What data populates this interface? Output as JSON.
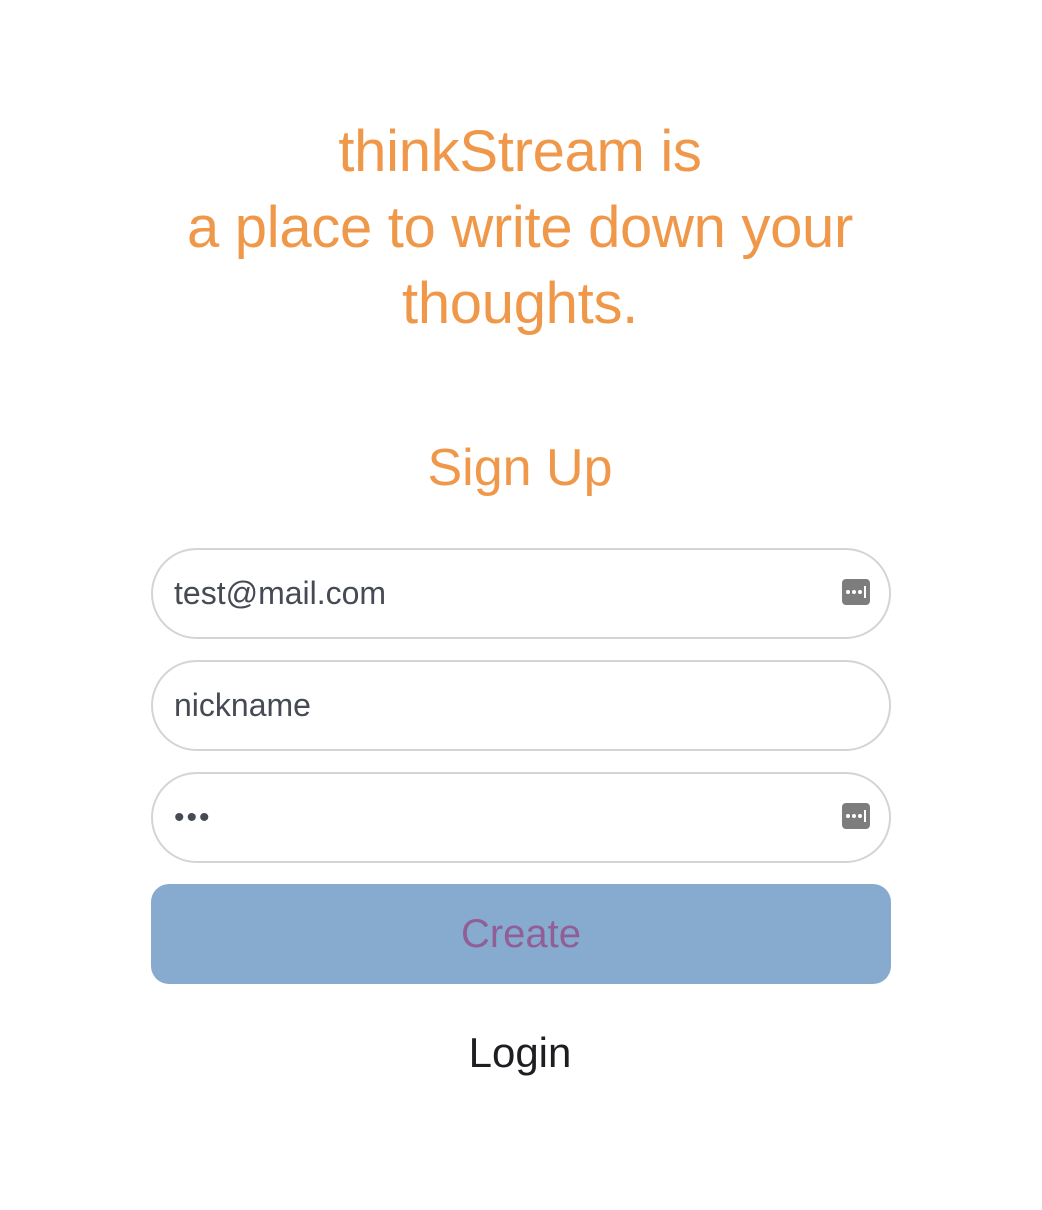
{
  "hero": {
    "line1": "thinkStream is",
    "line2": "a place to write down your",
    "line3": "thoughts."
  },
  "form": {
    "title": "Sign Up",
    "email_value": "test@mail.com",
    "nickname_value": "nickname",
    "password_value": "•••",
    "create_label": "Create",
    "login_label": "Login"
  },
  "icons": {
    "autofill": "password-autofill-key-icon"
  },
  "colors": {
    "accent": "#f0984a",
    "button_bg": "#86abce",
    "button_text": "#925e96",
    "field_border": "#d3d4d8",
    "field_text": "#454a55",
    "link_text": "#1d1e22"
  }
}
